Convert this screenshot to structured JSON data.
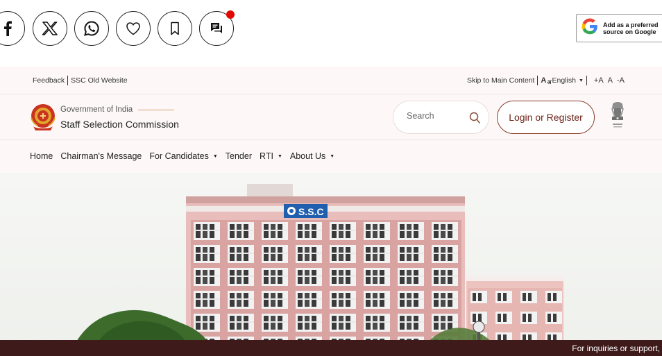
{
  "share_bar": {
    "icons": [
      "facebook-icon",
      "x-icon",
      "whatsapp-icon",
      "heart-icon",
      "bookmark-icon",
      "comments-icon"
    ],
    "notification_color": "#e10600",
    "google_card": {
      "text": "Add as a preferred\nsource on Google"
    }
  },
  "site": {
    "topbar": {
      "feedback": "Feedback",
      "old_website": "SSC Old Website",
      "skip_link": "Skip to Main Content",
      "lang_glyph": "A",
      "language": "English",
      "font_increase": "+A",
      "font_normal": "A",
      "font_decrease": "-A"
    },
    "header": {
      "gov_line": "Government of India",
      "org_name": "Staff Selection Commission",
      "search_placeholder": "Search",
      "login_label": "Login or Register"
    },
    "nav": [
      "Home",
      "Chairman's Message",
      "For Candidates",
      "Tender",
      "RTI",
      "About Us"
    ],
    "hero": {
      "building_sign": "S.S.C"
    },
    "support_text": "For inquiries or support,",
    "colors": {
      "accent": "#6b1f14",
      "support_bar": "#3e1a1a",
      "background": "#fdf8f7"
    }
  }
}
